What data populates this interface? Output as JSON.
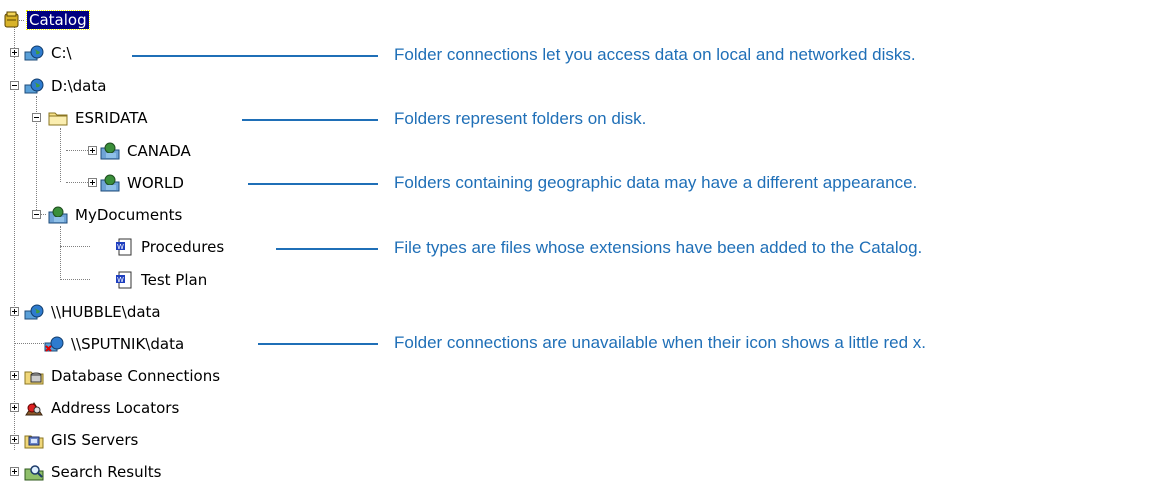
{
  "tree": {
    "root": {
      "label": "Catalog",
      "icon": "catalog-icon"
    },
    "nodes": [
      {
        "id": "c-drive",
        "label": "C:\\",
        "icon": "folder-connection-icon"
      },
      {
        "id": "d-data",
        "label": "D:\\data",
        "icon": "folder-connection-icon"
      },
      {
        "id": "esridata",
        "label": "ESRIDATA",
        "icon": "folder-icon"
      },
      {
        "id": "canada",
        "label": "CANADA",
        "icon": "geographic-folder-icon"
      },
      {
        "id": "world",
        "label": "WORLD",
        "icon": "geographic-folder-icon"
      },
      {
        "id": "mydocuments",
        "label": "MyDocuments",
        "icon": "geographic-folder-icon"
      },
      {
        "id": "procedures",
        "label": "Procedures",
        "icon": "word-document-icon"
      },
      {
        "id": "test-plan",
        "label": "Test Plan",
        "icon": "word-document-icon"
      },
      {
        "id": "hubble",
        "label": "\\\\HUBBLE\\data",
        "icon": "folder-connection-icon"
      },
      {
        "id": "sputnik",
        "label": "\\\\SPUTNIK\\data",
        "icon": "unavailable-folder-connection-icon"
      },
      {
        "id": "db-connections",
        "label": "Database Connections",
        "icon": "database-connections-icon"
      },
      {
        "id": "address-locators",
        "label": "Address Locators",
        "icon": "address-locators-icon"
      },
      {
        "id": "gis-servers",
        "label": "GIS Servers",
        "icon": "gis-servers-icon"
      },
      {
        "id": "search-results",
        "label": "Search Results",
        "icon": "search-results-icon"
      }
    ]
  },
  "callouts": [
    "Folder connections let you access data on local and networked disks.",
    "Folders represent folders on disk.",
    "Folders containing geographic data may have a different appearance.",
    "File types are files whose extensions have been added to the Catalog.",
    "Folder connections are unavailable when their icon shows a little red x."
  ],
  "colors": {
    "callout": "#1f6fb7",
    "selection": "#000080"
  }
}
